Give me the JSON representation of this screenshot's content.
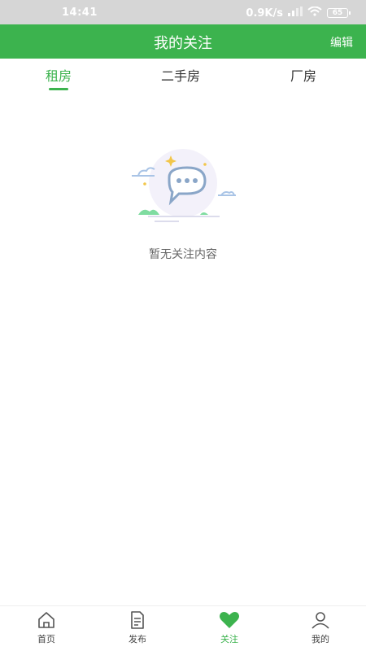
{
  "status_bar": {
    "time": "14:41",
    "network_speed": "0.9K/s",
    "battery": "65"
  },
  "header": {
    "title": "我的关注",
    "edit_label": "编辑"
  },
  "tabs": [
    {
      "label": "租房",
      "active": true
    },
    {
      "label": "二手房",
      "active": false
    },
    {
      "label": "厂房",
      "active": false
    }
  ],
  "empty_state": {
    "message": "暂无关注内容"
  },
  "bottom_nav": [
    {
      "label": "首页",
      "icon": "home-icon"
    },
    {
      "label": "发布",
      "icon": "document-icon"
    },
    {
      "label": "关注",
      "icon": "heart-icon",
      "active": true
    },
    {
      "label": "我的",
      "icon": "user-icon"
    }
  ],
  "colors": {
    "accent": "#3cb34e"
  }
}
